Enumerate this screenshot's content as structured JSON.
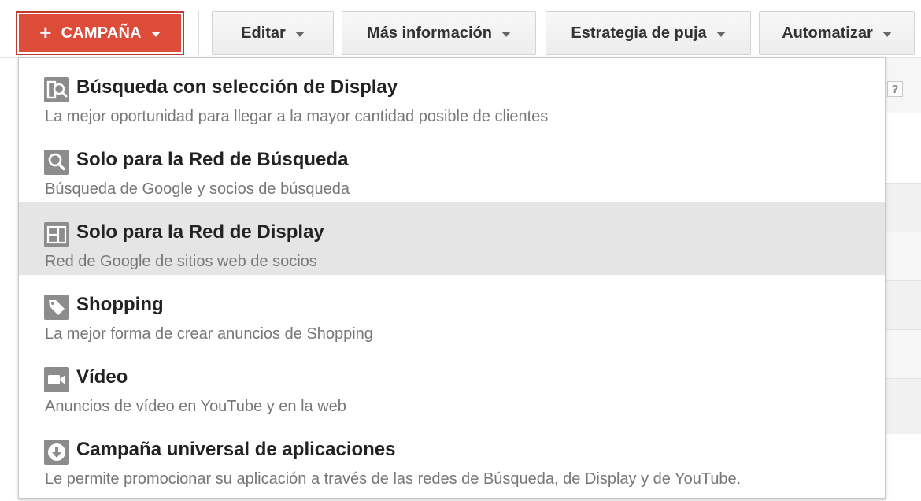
{
  "toolbar": {
    "campaign_label": "CAMPAÑA",
    "edit_label": "Editar",
    "more_info_label": "Más información",
    "bid_strategy_label": "Estrategia de puja",
    "automate_label": "Automatizar"
  },
  "background": {
    "help_label": "?"
  },
  "menu": {
    "items": [
      {
        "icon": "search-display-icon",
        "title": "Búsqueda con selección de Display",
        "description": "La mejor oportunidad para llegar a la mayor cantidad posible de clientes"
      },
      {
        "icon": "search-icon",
        "title": "Solo para la Red de Búsqueda",
        "description": "Búsqueda de Google y socios de búsqueda"
      },
      {
        "icon": "display-layout-icon",
        "title": "Solo para la Red de Display",
        "description": "Red de Google de sitios web de socios"
      },
      {
        "icon": "tag-icon",
        "title": "Shopping",
        "description": "La mejor forma de crear anuncios de Shopping"
      },
      {
        "icon": "video-camera-icon",
        "title": "Vídeo",
        "description": "Anuncios de vídeo en YouTube y en la web"
      },
      {
        "icon": "download-circle-icon",
        "title": "Campaña universal de aplicaciones",
        "description": "Le permite promocionar su aplicación a través de las redes de Búsqueda, de Display y de YouTube."
      }
    ],
    "highlighted_index": 2
  },
  "colors": {
    "campaign_button": "#dd4b39",
    "highlight_row": "#e5e5e5",
    "icon_bg": "#8c8c8c"
  }
}
